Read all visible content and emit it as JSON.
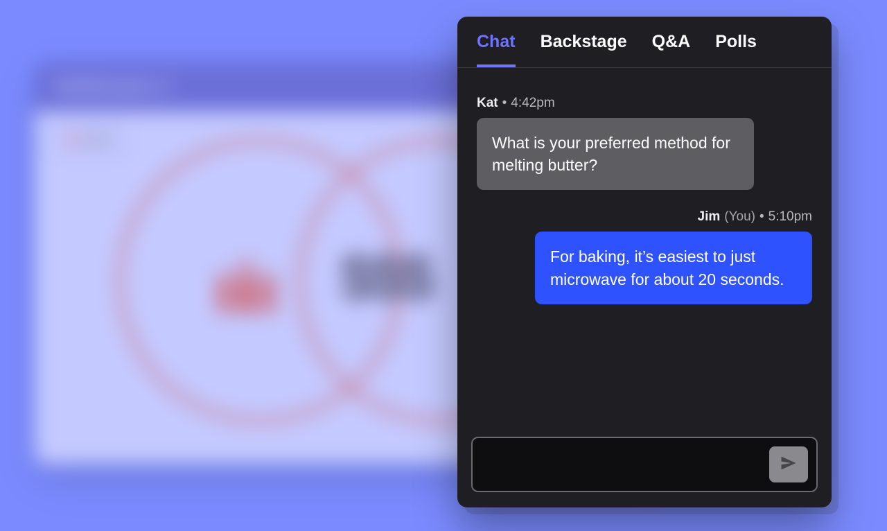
{
  "stage": {
    "brand_left": "BAKEforward.c X",
    "title_right": "Wisk-y Busi",
    "live_badge": "Live",
    "dollars": "$$$"
  },
  "tabs": [
    {
      "id": "chat",
      "label": "Chat",
      "active": true
    },
    {
      "id": "backstage",
      "label": "Backstage",
      "active": false
    },
    {
      "id": "qa",
      "label": "Q&A",
      "active": false
    },
    {
      "id": "polls",
      "label": "Polls",
      "active": false
    }
  ],
  "messages": [
    {
      "author": "Kat",
      "you": false,
      "time": "4:42pm",
      "text": "What is your preferred method for melting butter?"
    },
    {
      "author": "Jim",
      "you": true,
      "you_label": "(You)",
      "time": "5:10pm",
      "text": "For baking, it’s easiest to just microwave for about 20 seconds."
    }
  ],
  "input": {
    "value": "",
    "placeholder": ""
  },
  "meta_sep": "•"
}
